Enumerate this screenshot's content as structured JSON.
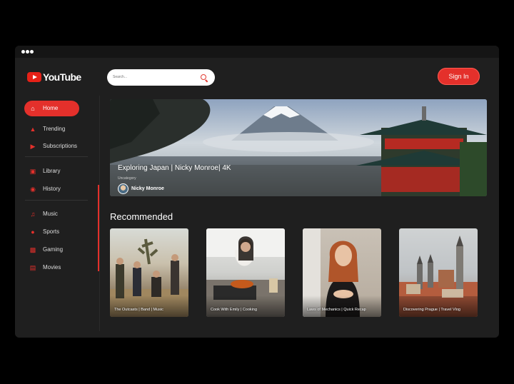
{
  "app": {
    "logo_text": "YouTube"
  },
  "search": {
    "placeholder": "Search..."
  },
  "header": {
    "sign_in": "Sign In"
  },
  "sidebar": {
    "items": [
      {
        "label": "Home",
        "icon": "home-icon",
        "active": true
      },
      {
        "label": "Trending",
        "icon": "fire-icon"
      },
      {
        "label": "Subscriptions",
        "icon": "subscriptions-icon"
      },
      {
        "label": "Library",
        "icon": "library-icon"
      },
      {
        "label": "History",
        "icon": "history-icon"
      },
      {
        "label": "Music",
        "icon": "music-icon"
      },
      {
        "label": "Sports",
        "icon": "sports-icon"
      },
      {
        "label": "Gaming",
        "icon": "gaming-icon"
      },
      {
        "label": "Movies",
        "icon": "movies-icon"
      }
    ]
  },
  "hero": {
    "title": "Exploring Japan | Nicky Monroe| 4K",
    "category": "Uncategory",
    "author": "Nicky Monroe"
  },
  "recommended": {
    "heading": "Recommended",
    "cards": [
      {
        "caption": "The Outcasts | Band | Music"
      },
      {
        "caption": "Cook With Emily | Cooking"
      },
      {
        "caption": "Laws of Mechanics | Quick Recap"
      },
      {
        "caption": "Discovering Prague | Travel Vlog"
      }
    ]
  },
  "colors": {
    "accent": "#e4302b",
    "background": "#1f1f1f"
  }
}
